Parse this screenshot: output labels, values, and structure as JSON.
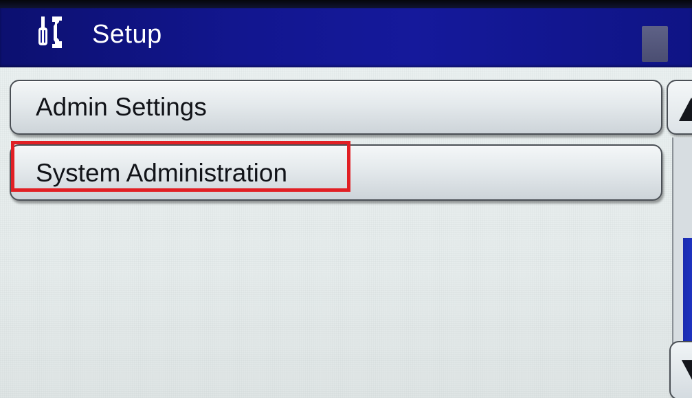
{
  "header": {
    "title": "Setup",
    "icon": "tools-icon"
  },
  "menu": {
    "items": [
      {
        "label": "Admin Settings"
      },
      {
        "label": "System Administration",
        "highlighted": true
      }
    ]
  },
  "scrollbar": {
    "up_icon": "scroll-up-arrow-icon",
    "down_icon": "scroll-down-arrow-icon"
  },
  "colors": {
    "titlebar": "#12168f",
    "highlight": "#e11f24",
    "scroll_thumb": "#1a2bb0"
  }
}
